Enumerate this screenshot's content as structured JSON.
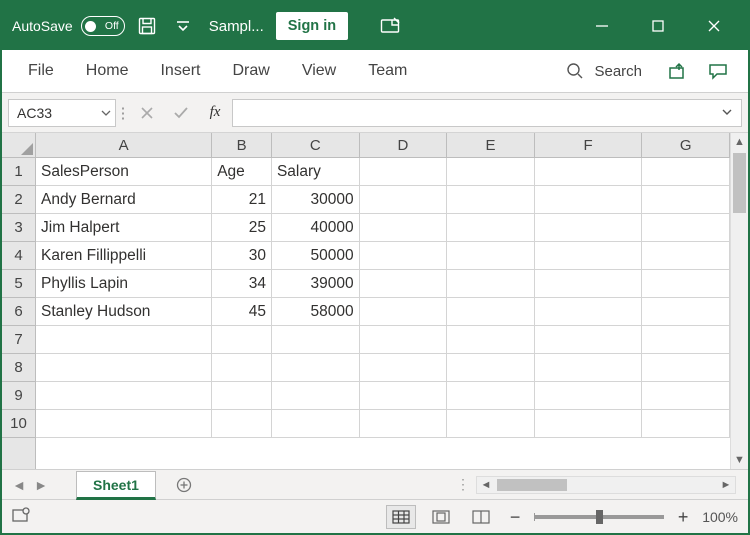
{
  "titlebar": {
    "autosave_label": "AutoSave",
    "autosave_state": "Off",
    "doc_title": "Sampl...",
    "sign_in": "Sign in"
  },
  "ribbon": {
    "tabs": [
      "File",
      "Home",
      "Insert",
      "Draw",
      "View",
      "Team"
    ],
    "search_label": "Search"
  },
  "formula": {
    "name_box": "AC33",
    "fx_label": "fx",
    "value": ""
  },
  "grid": {
    "columns": [
      "A",
      "B",
      "C",
      "D",
      "E",
      "F",
      "G"
    ],
    "row_labels": [
      "1",
      "2",
      "3",
      "4",
      "5",
      "6",
      "7",
      "8",
      "9",
      "10"
    ],
    "headers": {
      "a": "SalesPerson",
      "b": "Age",
      "c": "Salary"
    },
    "rows": [
      {
        "a": "Andy Bernard",
        "b": "21",
        "c": "30000"
      },
      {
        "a": "Jim Halpert",
        "b": "25",
        "c": "40000"
      },
      {
        "a": "Karen Fillippelli",
        "b": "30",
        "c": "50000"
      },
      {
        "a": "Phyllis Lapin",
        "b": "34",
        "c": "39000"
      },
      {
        "a": "Stanley Hudson",
        "b": "45",
        "c": "58000"
      }
    ]
  },
  "sheet": {
    "active_tab": "Sheet1"
  },
  "status": {
    "zoom": "100%"
  }
}
